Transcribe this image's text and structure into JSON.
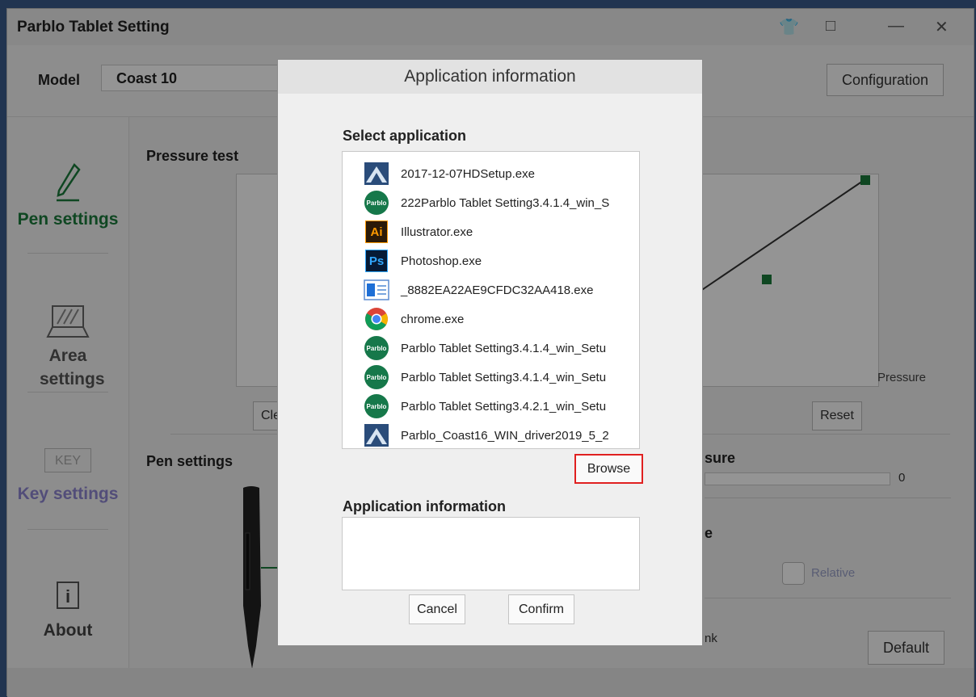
{
  "window": {
    "title": "Parblo Tablet Setting",
    "model_label": "Model",
    "model_value": "Coast 10",
    "configuration_button": "Configuration"
  },
  "sidebar": {
    "items": [
      {
        "label": "Pen settings",
        "icon": "pen-icon",
        "active": true
      },
      {
        "label": "Area settings",
        "icon": "tablet-icon"
      },
      {
        "label": "Key settings",
        "icon": "key-icon",
        "icon_text": "KEY"
      },
      {
        "label": "About",
        "icon": "info-icon"
      }
    ]
  },
  "main": {
    "pressure_test_title": "Pressure test",
    "pressure_axis_label": "Pressure",
    "clear_button_partial": "Cle",
    "reset_button": "Reset",
    "pen_settings_title": "Pen settings",
    "pressure_partial_label": "sure",
    "pressure_value": "0",
    "e_partial_label": "e",
    "relative_label": "Relative",
    "nk_partial_label": "nk",
    "default_button": "Default"
  },
  "dialog": {
    "title": "Application information",
    "select_application_label": "Select application",
    "applications": [
      {
        "name": "2017-12-07HDSetup.exe",
        "icon": "installer-icon"
      },
      {
        "name": "222Parblo Tablet Setting3.4.1.4_win_S",
        "icon": "parblo-icon"
      },
      {
        "name": "Illustrator.exe",
        "icon": "illustrator-icon",
        "icon_text": "Ai"
      },
      {
        "name": "Photoshop.exe",
        "icon": "photoshop-icon",
        "icon_text": "Ps"
      },
      {
        "name": "_8882EA22AE9CFDC32AA418.exe",
        "icon": "window-app-icon"
      },
      {
        "name": "chrome.exe",
        "icon": "chrome-icon"
      },
      {
        "name": "Parblo Tablet Setting3.4.1.4_win_Setu",
        "icon": "parblo-icon"
      },
      {
        "name": "Parblo Tablet Setting3.4.1.4_win_Setu",
        "icon": "parblo-icon"
      },
      {
        "name": "Parblo Tablet Setting3.4.2.1_win_Setu",
        "icon": "parblo-icon"
      },
      {
        "name": "Parblo_Coast16_WIN_driver2019_5_2",
        "icon": "installer-icon"
      }
    ],
    "parblo_icon_text": "Parblo",
    "browse_button": "Browse",
    "application_information_label": "Application information",
    "cancel_button": "Cancel",
    "confirm_button": "Confirm"
  },
  "colors": {
    "accent_green": "#1b7a3c",
    "highlight_red": "#e02020",
    "key_settings_blue": "#8d86d0"
  }
}
